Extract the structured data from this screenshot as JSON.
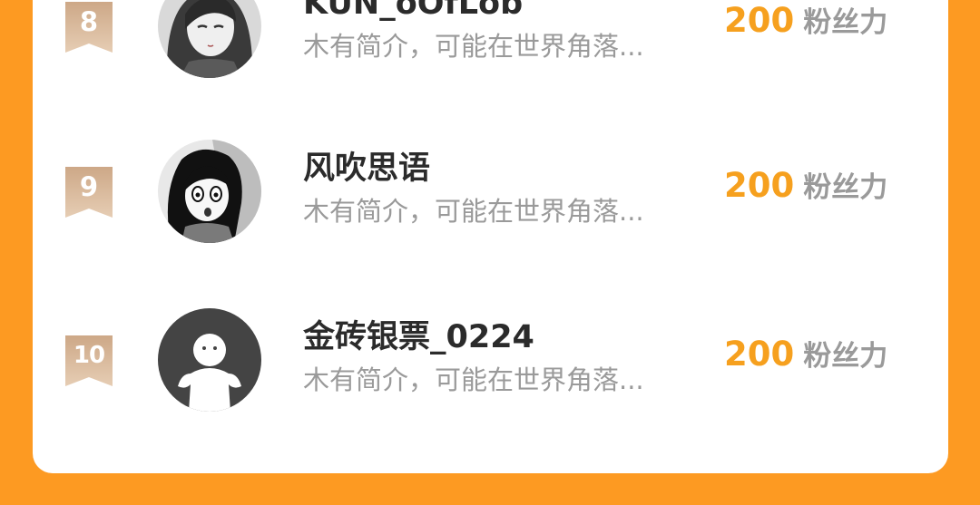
{
  "colors": {
    "background": "#FD9A22",
    "card": "#FFFFFF",
    "score": "#F6A01E",
    "name": "#2B2B2B",
    "muted": "#9A9A9A",
    "rank_badge": "#D8B796"
  },
  "ranking": [
    {
      "rank": "8",
      "name": "KUN_oOfLob",
      "bio": "木有简介，可能在世界角落...",
      "score": "200",
      "score_unit": "粉丝力",
      "avatar_icon": "anime-girl-avatar-icon"
    },
    {
      "rank": "9",
      "name": "风吹思语",
      "bio": "木有简介，可能在世界角落...",
      "score": "200",
      "score_unit": "粉丝力",
      "avatar_icon": "anime-character-avatar-icon"
    },
    {
      "rank": "10",
      "name": "金砖银票_0224",
      "bio": "木有简介，可能在世界角落...",
      "score": "200",
      "score_unit": "粉丝力",
      "avatar_icon": "default-user-avatar-icon"
    }
  ]
}
